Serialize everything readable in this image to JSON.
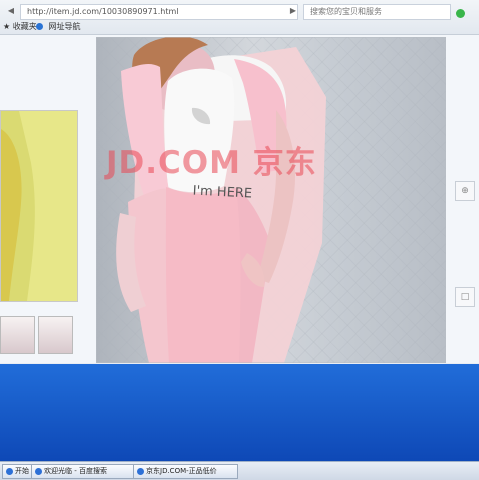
{
  "browser": {
    "url": "http://item.jd.com/10030890971.html",
    "search_placeholder": "搜索您的宝贝和服务",
    "back_label": "◀",
    "forward_label": "▶",
    "search_icon": "search-icon",
    "status_color": "#39b54a"
  },
  "bookmarks": [
    {
      "label": "收藏夹",
      "icon": "star-icon"
    },
    {
      "label": "网址导航",
      "icon": "globe-icon"
    }
  ],
  "product": {
    "watermark": "JD.COM 京东",
    "shirt_text": "I'm HERE"
  },
  "side_controls": {
    "expand_label": "⊕",
    "zoom_label": "□"
  },
  "taskbar": {
    "items": [
      "开始",
      "欢迎光临 - 百度搜索",
      "京东JD.COM-正品低价"
    ]
  }
}
